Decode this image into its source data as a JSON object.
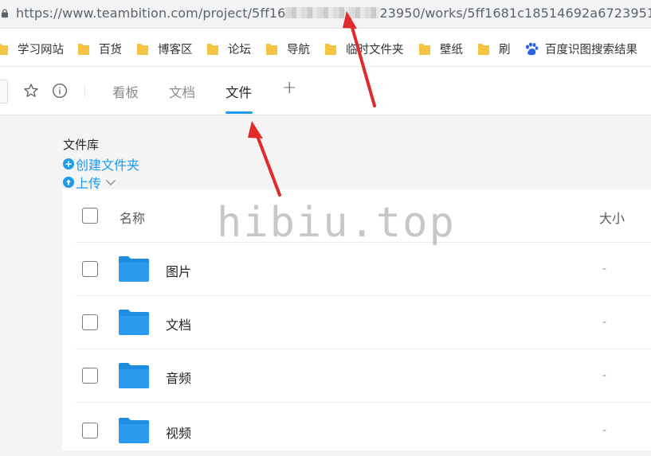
{
  "browser": {
    "url_prefix": "https://www.teambition.com/project/5ff16",
    "url_suffix": "23950/works/5ff1681c18514692a6723951"
  },
  "bookmarks": [
    {
      "label": "学习网站",
      "icon": "folder-icon"
    },
    {
      "label": "百货",
      "icon": "folder-icon"
    },
    {
      "label": "博客区",
      "icon": "folder-icon"
    },
    {
      "label": "论坛",
      "icon": "folder-icon"
    },
    {
      "label": "导航",
      "icon": "folder-icon"
    },
    {
      "label": "临时文件夹",
      "icon": "folder-icon"
    },
    {
      "label": "壁纸",
      "icon": "folder-icon"
    },
    {
      "label": "刷",
      "icon": "folder-icon"
    },
    {
      "label": "百度识图搜索结果",
      "icon": "baidu-paw-icon"
    }
  ],
  "nav": {
    "tabs": [
      {
        "label": "看板",
        "active": false
      },
      {
        "label": "文档",
        "active": false
      },
      {
        "label": "文件",
        "active": true
      }
    ],
    "add_label": "+"
  },
  "library": {
    "title": "文件库",
    "create_folder_label": "创建文件夹",
    "upload_label": "上传"
  },
  "table": {
    "columns": {
      "name": "名称",
      "size": "大小"
    },
    "rows": [
      {
        "name": "图片",
        "size": "-"
      },
      {
        "name": "文档",
        "size": "-"
      },
      {
        "name": "音频",
        "size": "-"
      },
      {
        "name": "视频",
        "size": "-"
      }
    ]
  },
  "watermark": "hibiu.top",
  "colors": {
    "accent": "#1b9aee",
    "folder": "#1e8ce0",
    "arrow": "#e02b2b",
    "bookmark_folder": "#f5c342"
  }
}
